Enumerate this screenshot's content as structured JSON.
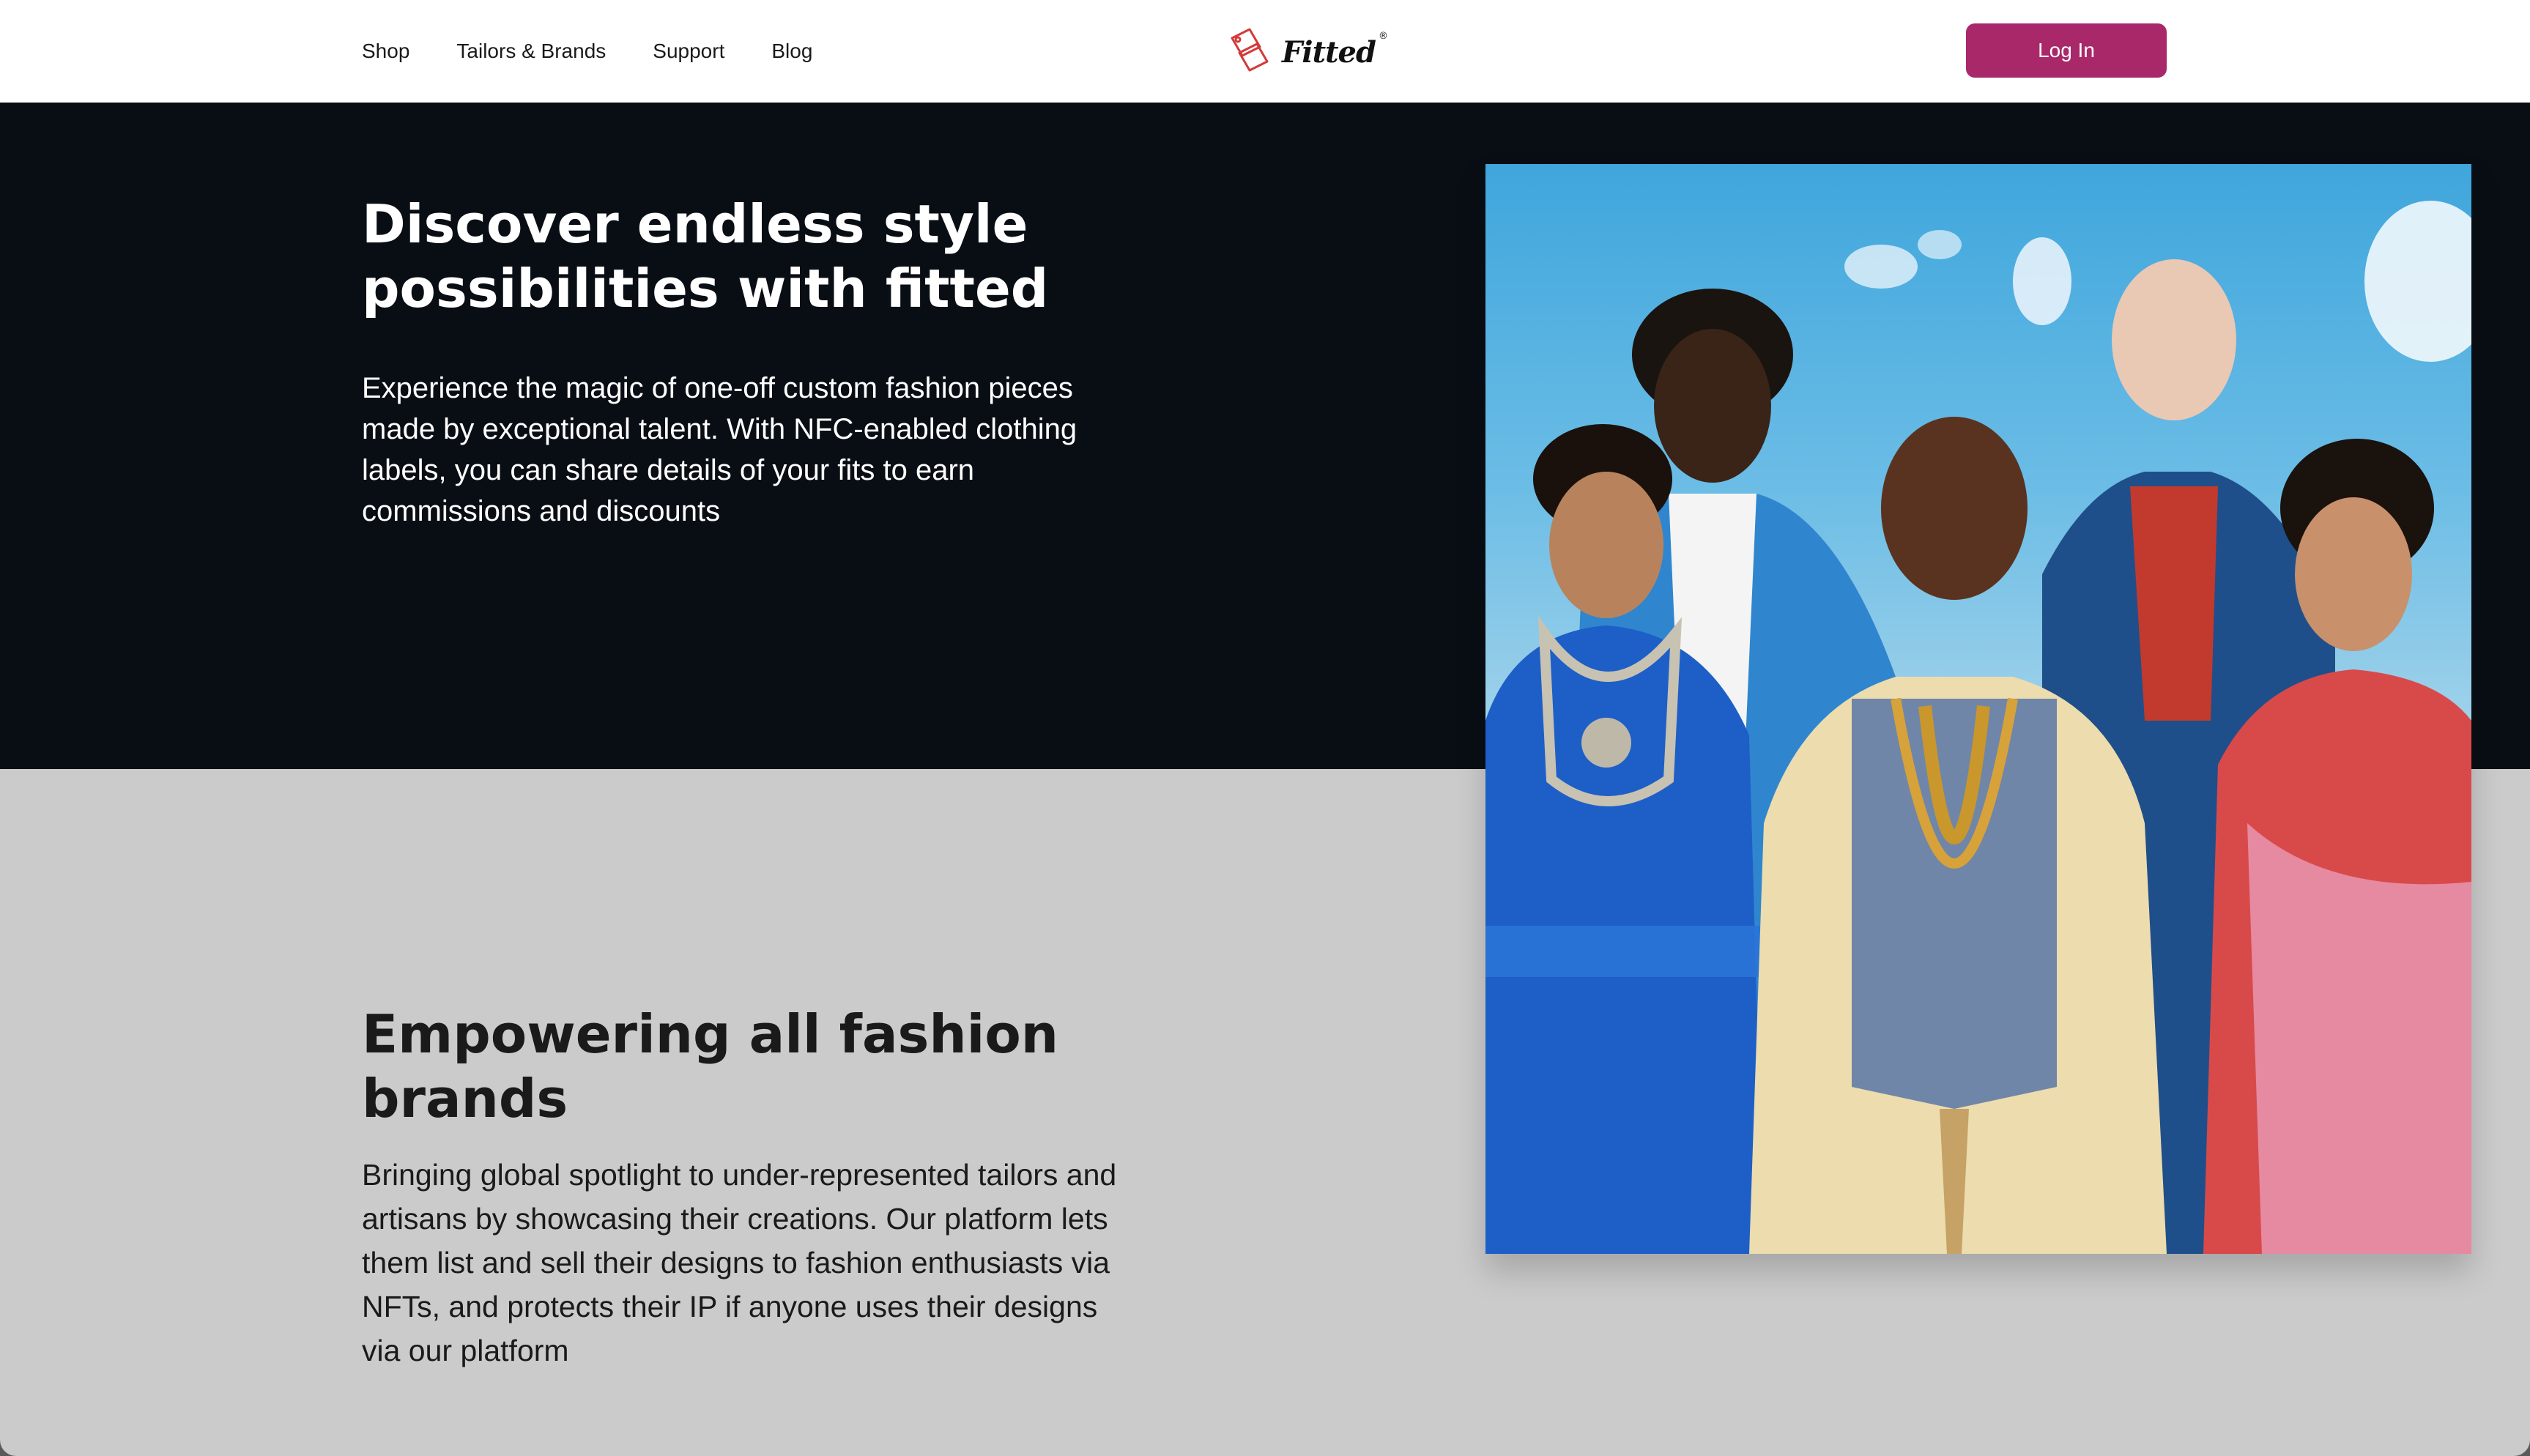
{
  "nav": {
    "items": [
      "Shop",
      "Tailors & Brands",
      "Support",
      "Blog"
    ]
  },
  "logo": {
    "text": "Fitted",
    "reg": "®"
  },
  "header": {
    "login_label": "Log In"
  },
  "hero": {
    "title": "Discover endless style possibilities with fitted",
    "description": "Experience the magic of one-off custom fashion pieces made by exceptional talent. With NFC-enabled clothing labels, you can share details of your fits to earn commissions and discounts"
  },
  "section2": {
    "title": "Empowering all fashion brands",
    "description": "Bringing global spotlight to under-represented tailors and artisans by showcasing their creations. Our platform lets them list and sell their designs to fashion enthusiasts via NFTs, and protects their IP if anyone uses their designs via our platform"
  },
  "colors": {
    "brand": "#a8286a",
    "hero_bg": "#090e15",
    "section_bg": "#cbcbcc",
    "logo_mark": "#d33a3a"
  }
}
